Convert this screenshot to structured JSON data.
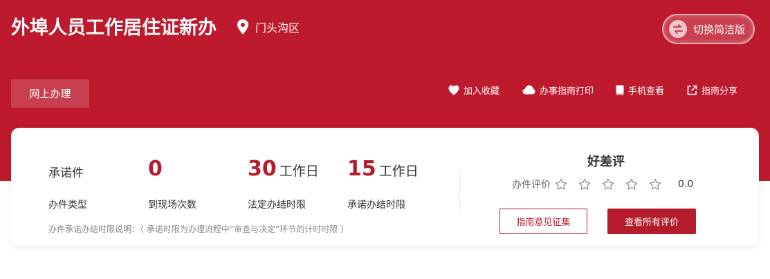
{
  "header": {
    "title": "外埠人员工作居住证新办",
    "location": "门头沟区",
    "toggle_label": "切换简洁版"
  },
  "toolbar": {
    "online_label": "网上办理",
    "favorite": "加入收藏",
    "print": "办事指南打印",
    "mobile": "手机查看",
    "share": "指南分享"
  },
  "stats": {
    "type_value": "承诺件",
    "type_label": "办件类型",
    "visits_value": "0",
    "visits_label": "到现场次数",
    "legal_value": "30",
    "legal_unit": "工作日",
    "legal_label": "法定办结时限",
    "promise_value": "15",
    "promise_unit": "工作日",
    "promise_label": "承诺办结时限",
    "note": "办件承诺办结时限说明：（ 承诺时限为办理流程中“审查与决定”环节的计时时限 ）"
  },
  "evaluation": {
    "title": "好差评",
    "label": "办件评价",
    "stars_filled": 0,
    "stars_total": 5,
    "score": "0.0",
    "feedback_button": "指南意见征集",
    "view_all_button": "查看所有评价"
  },
  "colors": {
    "brand_red": "#be1a2e",
    "accent_red": "#b41c2b"
  }
}
